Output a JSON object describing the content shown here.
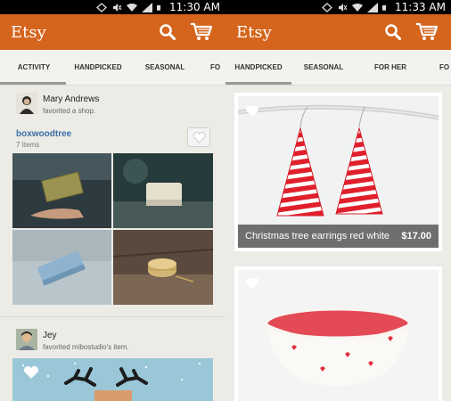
{
  "left": {
    "status": {
      "time": "11:30 AM"
    },
    "appbar": {
      "logo": "Etsy"
    },
    "tabs": [
      "ACTIVITY",
      "HANDPICKED",
      "SEASONAL",
      "FO"
    ],
    "feed": [
      {
        "user": "Mary Andrews",
        "action": "favorited a shop.",
        "shop": "boxwoodtree",
        "count": "7 Items"
      },
      {
        "user": "Jey",
        "action": "favorited mibostudio's item."
      }
    ]
  },
  "right": {
    "status": {
      "time": "11:33 AM"
    },
    "appbar": {
      "logo": "Etsy"
    },
    "tabs": [
      "HANDPICKED",
      "SEASONAL",
      "FOR HER",
      "FO"
    ],
    "items": [
      {
        "title": "Christmas tree earrings red white",
        "price": "$17.00"
      }
    ]
  },
  "colors": {
    "brand": "#d5641c",
    "link": "#3a6ea5"
  }
}
